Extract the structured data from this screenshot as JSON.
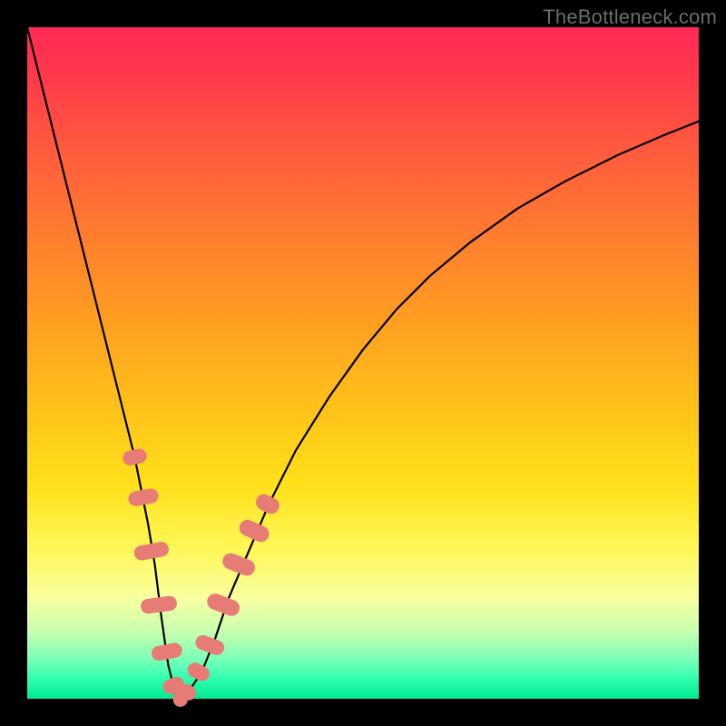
{
  "watermark": "TheBottleneck.com",
  "chart_data": {
    "type": "line",
    "title": "",
    "xlabel": "",
    "ylabel": "",
    "xlim": [
      0,
      100
    ],
    "ylim": [
      0,
      100
    ],
    "grid": false,
    "legend": false,
    "background_gradient": {
      "direction": "vertical",
      "stops": [
        {
          "pos": 0.0,
          "color": "#ff2a55"
        },
        {
          "pos": 0.5,
          "color": "#ffbd1a"
        },
        {
          "pos": 0.8,
          "color": "#fff85a"
        },
        {
          "pos": 1.0,
          "color": "#00e890"
        }
      ]
    },
    "series": [
      {
        "name": "bottleneck-curve",
        "x": [
          0,
          2,
          4,
          6,
          8,
          10,
          12,
          14,
          16,
          18,
          19,
          20,
          21,
          22,
          23,
          24,
          26,
          28,
          30,
          33,
          36,
          40,
          45,
          50,
          55,
          60,
          66,
          73,
          80,
          88,
          95,
          100
        ],
        "y": [
          100,
          92,
          84,
          76,
          68,
          60,
          52,
          44,
          36,
          26,
          20,
          12,
          5,
          1,
          0,
          1,
          4,
          9,
          15,
          22,
          29,
          37,
          45,
          52,
          58,
          63,
          68,
          73,
          77,
          81,
          84,
          86
        ]
      }
    ],
    "markers": {
      "name": "highlight-dots",
      "color": "#e77c77",
      "shape": "rounded-rect",
      "points": [
        {
          "x": 16.0,
          "y": 36,
          "w": 2.2,
          "h": 3.6
        },
        {
          "x": 17.3,
          "y": 30,
          "w": 2.2,
          "h": 4.5
        },
        {
          "x": 18.5,
          "y": 22,
          "w": 2.2,
          "h": 5.2
        },
        {
          "x": 19.6,
          "y": 14,
          "w": 2.2,
          "h": 5.4
        },
        {
          "x": 20.8,
          "y": 7,
          "w": 2.2,
          "h": 4.6
        },
        {
          "x": 21.8,
          "y": 2,
          "w": 2.2,
          "h": 3.2
        },
        {
          "x": 22.8,
          "y": 0,
          "w": 2.2,
          "h": 2.4
        },
        {
          "x": 23.9,
          "y": 1,
          "w": 2.2,
          "h": 2.6
        },
        {
          "x": 25.5,
          "y": 4,
          "w": 2.2,
          "h": 3.4
        },
        {
          "x": 27.2,
          "y": 8,
          "w": 2.2,
          "h": 4.4
        },
        {
          "x": 29.2,
          "y": 14,
          "w": 2.4,
          "h": 5.0
        },
        {
          "x": 31.5,
          "y": 20,
          "w": 2.4,
          "h": 5.0
        },
        {
          "x": 33.8,
          "y": 25,
          "w": 2.4,
          "h": 4.6
        },
        {
          "x": 35.8,
          "y": 29,
          "w": 2.4,
          "h": 3.6
        }
      ]
    }
  }
}
